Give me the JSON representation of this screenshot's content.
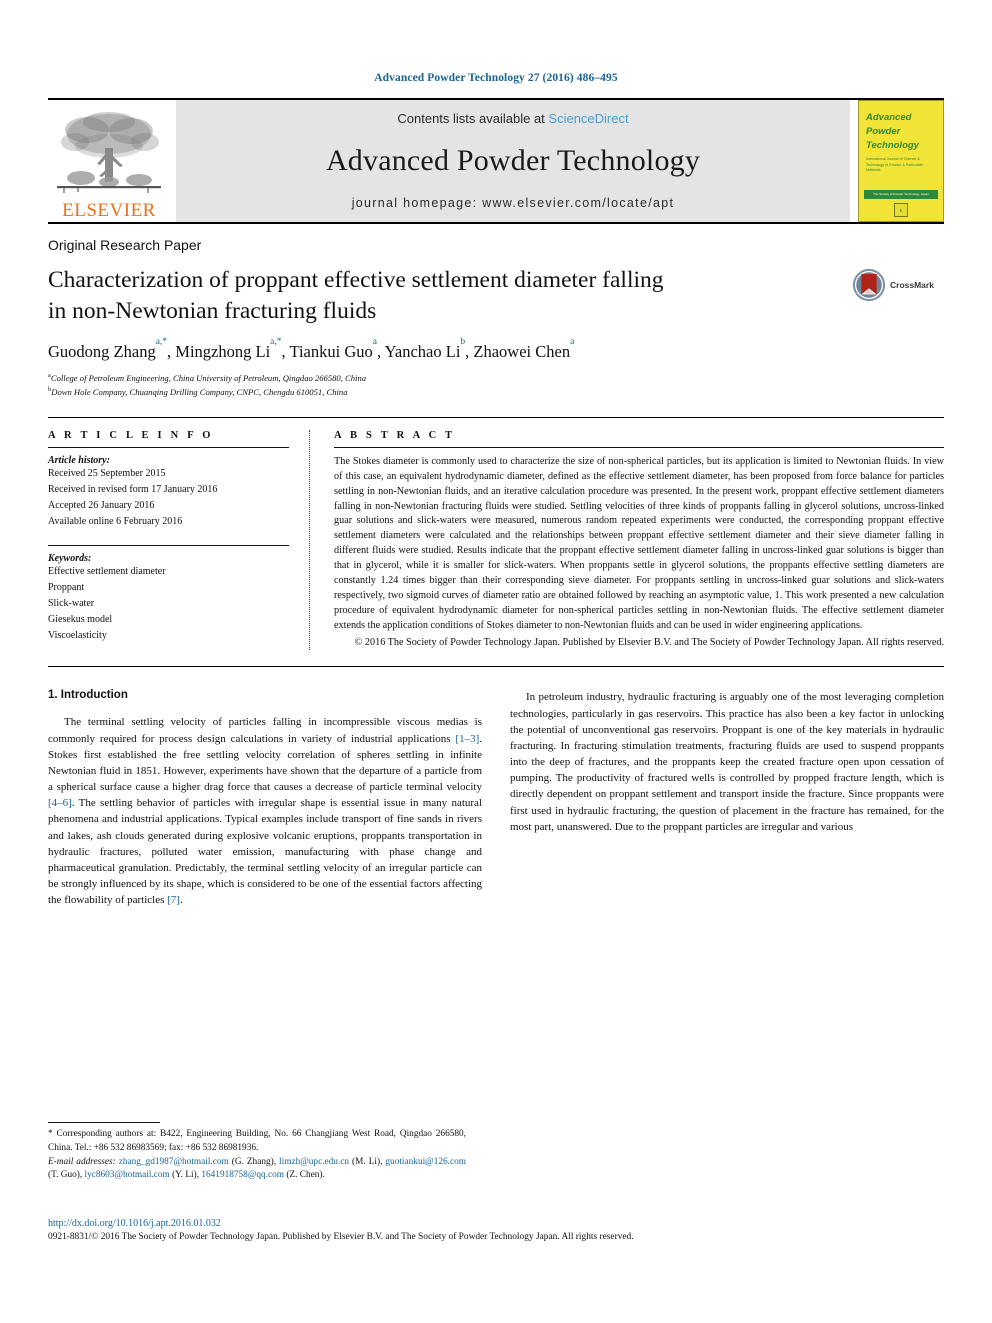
{
  "running_head": "Advanced Powder Technology 27 (2016) 486–495",
  "masthead": {
    "contents_prefix": "Contents lists available at ",
    "sciencedirect": "ScienceDirect",
    "journal_title": "Advanced Powder Technology",
    "homepage": "journal homepage: www.elsevier.com/locate/apt",
    "publisher_logo_text": "ELSEVIER",
    "publisher_logo_icon": "elsevier-tree-icon",
    "cover": {
      "line1": "Advanced",
      "line2": "Powder",
      "line3": "Technology",
      "subtitle": "International Journal of Science & Technology of Powder & Particulate Materials",
      "greenbar_text": "The Society of Powder Technology, Japan",
      "mark": "E"
    }
  },
  "article": {
    "type": "Original Research Paper",
    "title_line1": "Characterization of proppant effective settlement diameter falling",
    "title_line2": "in non-Newtonian fracturing fluids",
    "crossmark_label": "CrossMark",
    "crossmark_icon": "crossmark-badge-icon",
    "authors": [
      {
        "name": "Guodong Zhang",
        "sup": "a,*",
        "sep": ", "
      },
      {
        "name": "Mingzhong Li",
        "sup": "a,*",
        "sep": ", "
      },
      {
        "name": "Tiankui Guo",
        "sup": "a",
        "sep": ", "
      },
      {
        "name": "Yanchao Li",
        "sup": "b",
        "sep": ", "
      },
      {
        "name": "Zhaowei Chen",
        "sup": "a",
        "sep": ""
      }
    ],
    "affiliations": [
      {
        "sup": "a",
        "text": "College of Petroleum Engineering, China University of Petroleum, Qingdao 266580, China"
      },
      {
        "sup": "b",
        "text": "Down Hole Company, Chuanqing Drilling Company, CNPC, Chengdu 610051, China"
      }
    ]
  },
  "article_info": {
    "heading": "A R T I C L E    I N F O",
    "history_label": "Article history:",
    "history": [
      "Received 25 September 2015",
      "Received in revised form 17 January 2016",
      "Accepted 26 January 2016",
      "Available online 6 February 2016"
    ],
    "keywords_label": "Keywords:",
    "keywords": [
      "Effective settlement diameter",
      "Proppant",
      "Slick-water",
      "Giesekus model",
      "Viscoelasticity"
    ]
  },
  "abstract": {
    "heading": "A B S T R A C T",
    "body": "The Stokes diameter is commonly used to characterize the size of non-spherical particles, but its application is limited to Newtonian fluids. In view of this case, an equivalent hydrodynamic diameter, defined as the effective settlement diameter, has been proposed from force balance for particles settling in non-Newtonian fluids, and an iterative calculation procedure was presented. In the present work, proppant effective settlement diameters falling in non-Newtonian fracturing fluids were studied. Settling velocities of three kinds of proppants falling in glycerol solutions, uncross-linked guar solutions and slick-waters were measured, numerous random repeated experiments were conducted, the corresponding proppant effective settlement diameters were calculated and the relationships between proppant effective settlement diameter and their sieve diameter falling in different fluids were studied. Results indicate that the proppant effective settlement diameter falling in uncross-linked guar solutions is bigger than that in glycerol, while it is smaller for slick-waters. When proppants settle in glycerol solutions, the proppants effective settling diameters are constantly 1.24 times bigger than their corresponding sieve diameter. For proppants settling in uncross-linked guar solutions and slick-waters respectively, two sigmoid curves of diameter ratio are obtained followed by reaching an asymptotic value, 1. This work presented a new calculation procedure of equivalent hydrodynamic diameter for non-spherical particles settling in non-Newtonian fluids. The effective settlement diameter extends the application conditions of Stokes diameter to non-Newtonian fluids and can be used in wider engineering applications.",
    "copyright": "© 2016 The Society of Powder Technology Japan. Published by Elsevier B.V. and The Society of Powder Technology Japan. All rights reserved."
  },
  "introduction": {
    "heading": "1. Introduction",
    "left_p1_a": "The terminal settling velocity of particles falling in incompressible viscous medias is commonly required for process design calculations in variety of industrial applications ",
    "left_p1_ref1": "[1–3]",
    "left_p1_b": ". Stokes first established the free settling velocity correlation of spheres settling in infinite Newtonian fluid in 1851. However, experiments have shown that the departure of a particle from a spherical surface cause a higher drag force that causes a decrease of particle terminal velocity ",
    "left_p1_ref2": "[4–6]",
    "left_p1_c": ". The settling behavior of particles with irregular shape is essential issue in many natural phenomena and industrial applications. Typical examples include transport of fine sands in rivers and lakes, ash clouds generated during explosive volcanic eruptions, proppants transportation in hydraulic fractures, polluted water emission, manufacturing with phase change and pharmaceutical granulation. Predictably, the terminal settling velocity of an irregular particle can be strongly influenced by its shape, which is considered to be one of the essential factors affecting the flowability of particles ",
    "right_p1_ref3": "[7]",
    "right_p1_end": ".",
    "right_p2": "In petroleum industry, hydraulic fracturing is arguably one of the most leveraging completion technologies, particularly in gas reservoirs. This practice has also been a key factor in unlocking the potential of unconventional gas reservoirs. Proppant is one of the key materials in hydraulic fracturing. In fracturing stimulation treatments, fracturing fluids are used to suspend proppants into the deep of fractures, and the proppants keep the created fracture open upon cessation of pumping. The productivity of fractured wells is controlled by propped fracture length, which is directly dependent on proppant settlement and transport inside the fracture. Since proppants were first used in hydraulic fracturing, the question of placement in the fracture has remained, for the most part, unanswered. Due to the proppant particles are irregular and various"
  },
  "footnote": {
    "corresponding": "* Corresponding authors at: B422, Engineering Building, No. 66 Changjiang West Road, Qingdao 266580, China. Tel.: +86 532 86983569; fax: +86 532 86981936.",
    "email_label": "E-mail addresses:",
    "emails": [
      {
        "mail": "zhang_gd1987@hotmail.com",
        "who": " (G. Zhang), "
      },
      {
        "mail": "limzh@upc.edu.cn",
        "who": " (M. Li), "
      },
      {
        "mail": "guotiankui@126.com",
        "who": " (T. Guo), "
      },
      {
        "mail": "lyc8603@hotmail.com",
        "who": " (Y. Li), "
      },
      {
        "mail": "1641918758@qq.com",
        "who": " (Z. Chen)."
      }
    ]
  },
  "bottom": {
    "doi": "http://dx.doi.org/10.1016/j.apt.2016.01.032",
    "issn": "0921-8831/© 2016 The Society of Powder Technology Japan. Published by Elsevier B.V. and The Society of Powder Technology Japan. All rights reserved."
  },
  "colors": {
    "link_blue": "#1a6496",
    "sciencedirect_blue": "#4a9fd4",
    "elsevier_orange": "#E9711C",
    "cover_yellow": "#f2e436",
    "cover_green": "#2c8a3c",
    "masthead_gray": "#e4e4e4",
    "crossmark_red": "#b02418"
  }
}
